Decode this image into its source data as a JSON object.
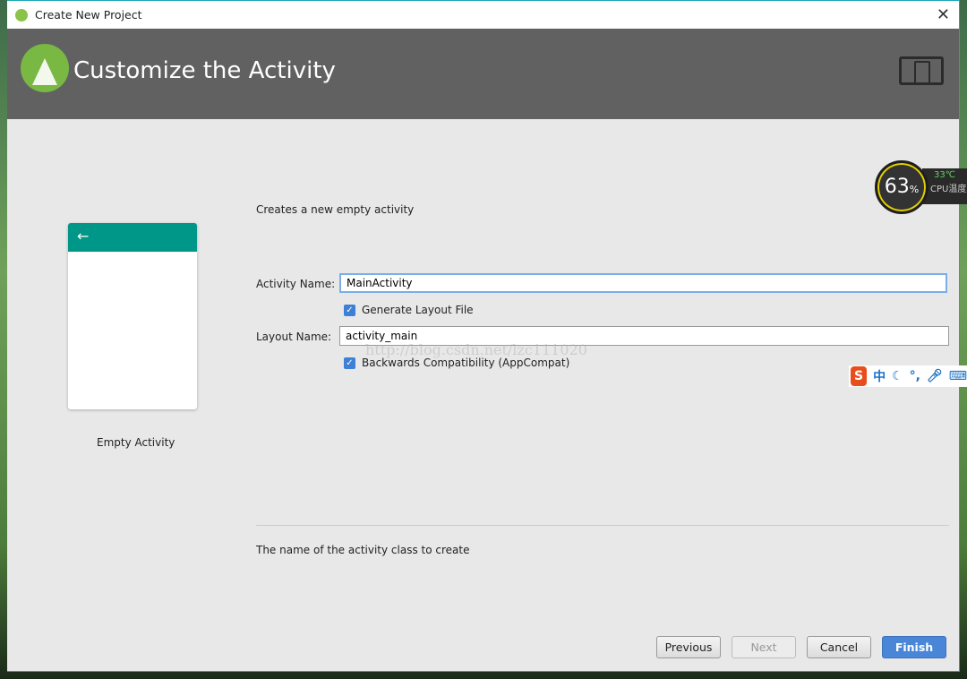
{
  "window": {
    "title": "Create New Project"
  },
  "header": {
    "title": "Customize the Activity"
  },
  "template": {
    "name": "Empty Activity",
    "back_icon": "←"
  },
  "form": {
    "description": "Creates a new empty activity",
    "activity_name_label": "Activity Name:",
    "activity_name_value": "MainActivity",
    "generate_layout_label": "Generate Layout File",
    "generate_layout_checked": true,
    "layout_name_label": "Layout Name:",
    "layout_name_value": "activity_main",
    "backwards_compat_label": "Backwards Compatibility (AppCompat)",
    "backwards_compat_checked": true,
    "help_text": "The name of the activity class to create"
  },
  "watermark": "http://blog.csdn.net/lzc111020",
  "buttons": {
    "previous": "Previous",
    "next": "Next",
    "cancel": "Cancel",
    "finish": "Finish"
  },
  "overlay": {
    "cpu_percent": "63",
    "cpu_unit": "%",
    "cpu_temp": "33℃",
    "cpu_label": "CPU温度",
    "ime_logo": "S",
    "ime_mode": "中",
    "ime_icons": [
      "moon-icon",
      "punctuation-icon",
      "microphone-icon",
      "keyboard-icon"
    ]
  },
  "colors": {
    "header": "#616161",
    "accent": "#009688",
    "primary_button": "#4a86d8"
  }
}
